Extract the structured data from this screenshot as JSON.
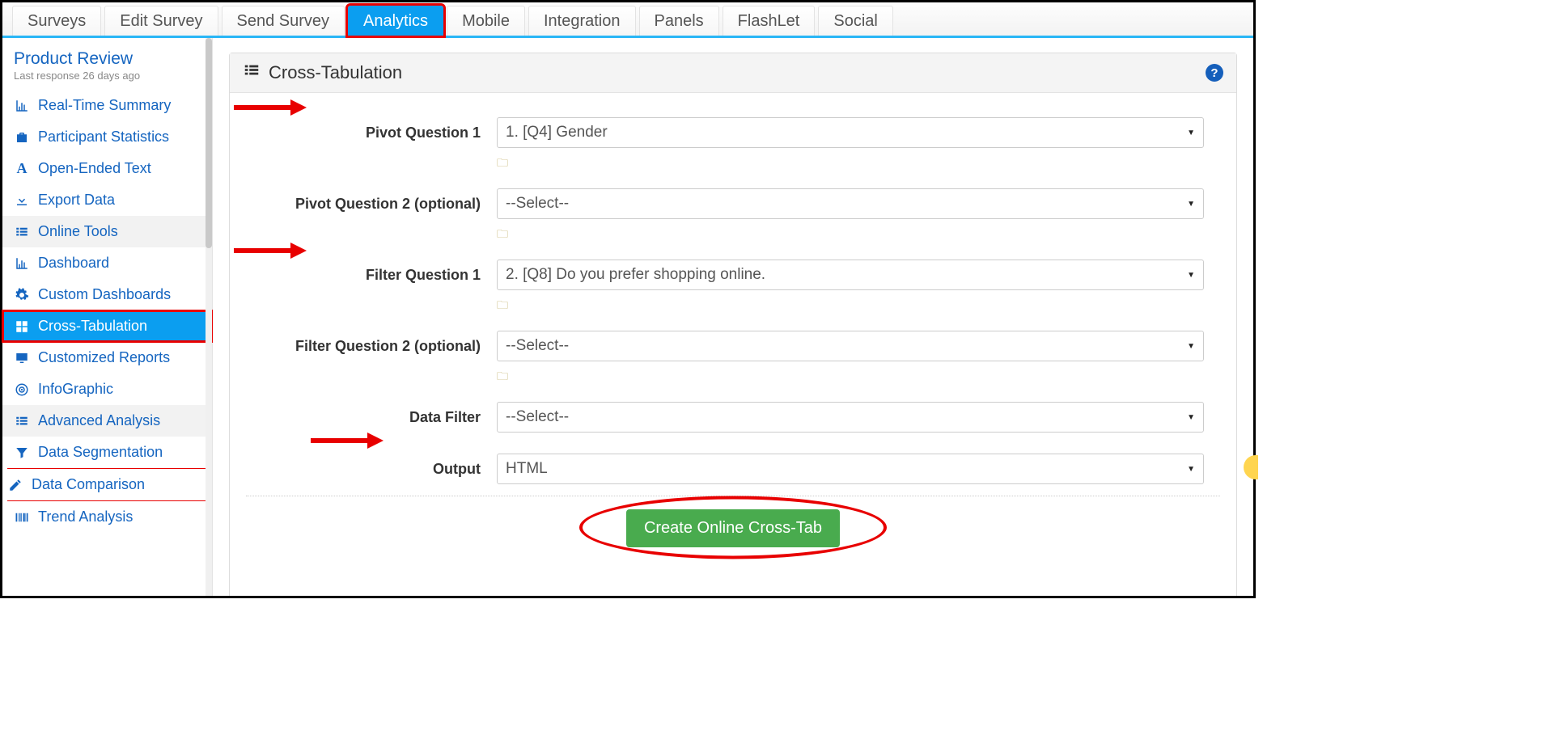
{
  "topnav": {
    "tabs": [
      {
        "label": "Surveys",
        "active": false
      },
      {
        "label": "Edit Survey",
        "active": false
      },
      {
        "label": "Send Survey",
        "active": false
      },
      {
        "label": "Analytics",
        "active": true
      },
      {
        "label": "Mobile",
        "active": false
      },
      {
        "label": "Integration",
        "active": false
      },
      {
        "label": "Panels",
        "active": false
      },
      {
        "label": "FlashLet",
        "active": false
      },
      {
        "label": "Social",
        "active": false
      }
    ]
  },
  "sidebar": {
    "survey_title": "Product Review",
    "last_response": "Last response 26 days ago",
    "items": [
      {
        "label": "Real-Time Summary",
        "icon": "bar-chart-icon",
        "type": "item"
      },
      {
        "label": "Participant Statistics",
        "icon": "briefcase-icon",
        "type": "item"
      },
      {
        "label": "Open-Ended Text",
        "icon": "font-icon",
        "type": "item"
      },
      {
        "label": "Export Data",
        "icon": "download-icon",
        "type": "item"
      },
      {
        "label": "Online Tools",
        "icon": "list-icon",
        "type": "group"
      },
      {
        "label": "Dashboard",
        "icon": "bar-chart-icon",
        "type": "item"
      },
      {
        "label": "Custom Dashboards",
        "icon": "gear-icon",
        "type": "item"
      },
      {
        "label": "Cross-Tabulation",
        "icon": "grid-icon",
        "type": "item",
        "active": true
      },
      {
        "label": "Customized Reports",
        "icon": "monitor-icon",
        "type": "item"
      },
      {
        "label": "InfoGraphic",
        "icon": "target-icon",
        "type": "item"
      },
      {
        "label": "Advanced Analysis",
        "icon": "list-icon",
        "type": "group"
      },
      {
        "label": "Data Segmentation",
        "icon": "filter-icon",
        "type": "item"
      },
      {
        "label": "Data Comparison",
        "icon": "edit-icon",
        "type": "item"
      },
      {
        "label": "Trend Analysis",
        "icon": "barcode-icon",
        "type": "item"
      }
    ]
  },
  "panel": {
    "title": "Cross-Tabulation",
    "help": "?",
    "rows": {
      "pivot1": {
        "label": "Pivot Question 1",
        "value": "1. [Q4] Gender"
      },
      "pivot2": {
        "label": "Pivot Question 2 (optional)",
        "value": "--Select--"
      },
      "filter1": {
        "label": "Filter Question 1",
        "value": "2. [Q8] Do you prefer shopping online."
      },
      "filter2": {
        "label": "Filter Question 2 (optional)",
        "value": "--Select--"
      },
      "datafilter": {
        "label": "Data Filter",
        "value": "--Select--"
      },
      "output": {
        "label": "Output",
        "value": "HTML"
      }
    },
    "button": "Create Online Cross-Tab"
  }
}
